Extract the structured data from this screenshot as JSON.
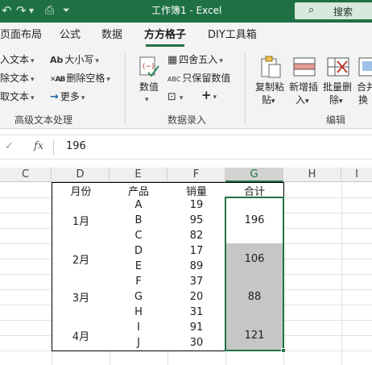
{
  "titlebar": {
    "title": "工作簿1 - Excel",
    "search_label": "搜索",
    "undo_icon": "undo-icon",
    "redo_icon": "redo-icon",
    "customize_icon": "customize-quick-access-icon"
  },
  "tabs": [
    {
      "label": "页面布局"
    },
    {
      "label": "公式"
    },
    {
      "label": "数据"
    },
    {
      "label": "方方格子"
    },
    {
      "label": "DIY工具箱"
    }
  ],
  "ribbon": {
    "text_group": {
      "items": [
        {
          "label": "入文本"
        },
        {
          "label": "除文本"
        },
        {
          "label": "取文本"
        }
      ],
      "label": "高级文本处理"
    },
    "case_group": {
      "items": [
        {
          "label": "大小写",
          "icon_text": "Ab"
        },
        {
          "label": "删除空格",
          "icon_text": "AB"
        },
        {
          "label": "更多"
        }
      ]
    },
    "numeric_group": {
      "number_label": "数值",
      "round_label": "四舍五入",
      "keep_label": "只保留数值",
      "label": "数据录入"
    },
    "edit_group": {
      "buttons": [
        {
          "line1": "复制粘",
          "line2": "贴"
        },
        {
          "line1": "新增插",
          "line2": "入"
        },
        {
          "line1": "批量删",
          "line2": "除"
        },
        {
          "line1": "合并",
          "line2": "换"
        }
      ],
      "label": "编辑"
    }
  },
  "formula_bar": {
    "fx": "fx",
    "value": "196"
  },
  "columns": [
    "C",
    "D",
    "E",
    "F",
    "G",
    "H",
    "I"
  ],
  "table": {
    "headers": [
      "月份",
      "产品",
      "销量",
      "合计"
    ],
    "months": [
      "1月",
      "2月",
      "3月",
      "4月"
    ],
    "products": [
      "A",
      "B",
      "C",
      "D",
      "E",
      "F",
      "G",
      "H",
      "I",
      "J"
    ],
    "sales": [
      "19",
      "95",
      "82",
      "17",
      "89",
      "37",
      "20",
      "31",
      "91",
      "30"
    ],
    "totals": [
      "196",
      "106",
      "88",
      "121"
    ]
  },
  "colors": {
    "accent": "#217346",
    "titlebar": "#1f7145",
    "selection_fill": "#c6c6c6"
  }
}
